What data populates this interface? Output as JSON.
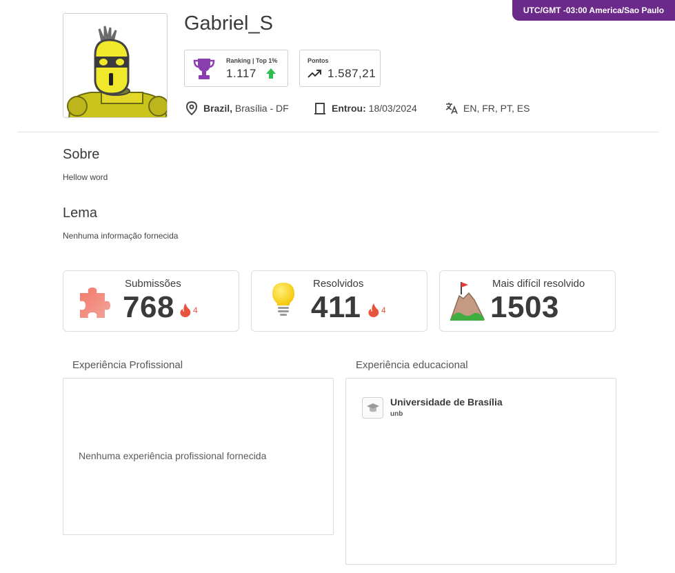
{
  "timezone": "UTC/GMT -03:00 America/Sao Paulo",
  "profile": {
    "username": "Gabriel_S",
    "avatar": "yellow-robot-avatar",
    "ranking_label": "Ranking | Top 1%",
    "ranking_value": "1.117",
    "pontos_label": "Pontos",
    "pontos_value": "1.587,21",
    "country": "Brazil,",
    "city": "Brasília - DF",
    "joined_label": "Entrou:",
    "joined_date": "18/03/2024",
    "languages": "EN, FR, PT, ES"
  },
  "about": {
    "title": "Sobre",
    "text": "Hellow word"
  },
  "motto": {
    "title": "Lema",
    "text": "Nenhuma informação fornecida"
  },
  "stats": {
    "submissions": {
      "label": "Submissões",
      "value": "768",
      "streak": "4",
      "icon": "puzzle-icon"
    },
    "solved": {
      "label": "Resolvidos",
      "value": "411",
      "streak": "4",
      "icon": "lightbulb-icon"
    },
    "hardest": {
      "label": "Mais difícil resolvido",
      "value": "1503",
      "icon": "mountain-flag-icon"
    }
  },
  "experience": {
    "professional_title": "Experiência Profissional",
    "professional_empty": "Nenhuma experiência profissional fornecida",
    "education_title": "Experiência educacional",
    "education": [
      {
        "name": "Universidade de Brasília",
        "short": "unb"
      }
    ]
  },
  "colors": {
    "accent": "#6b2a8a",
    "streak": "#e8533f",
    "up_arrow": "#2ebd4f"
  }
}
